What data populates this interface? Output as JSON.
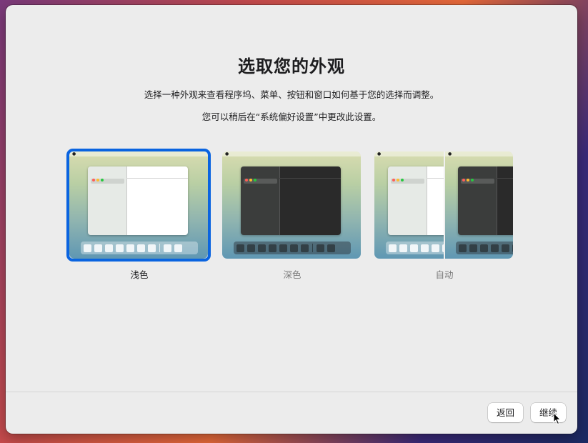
{
  "window": {
    "title": "选取您的外观",
    "description": "选择一种外观来查看程序坞、菜单、按钮和窗口如何基于您的选择而调整。",
    "note": "您可以稍后在“系统偏好设置”中更改此设置。"
  },
  "appearance_options": [
    {
      "id": "light",
      "label": "浅色",
      "selected": true
    },
    {
      "id": "dark",
      "label": "深色",
      "selected": false
    },
    {
      "id": "auto",
      "label": "自动",
      "selected": false
    }
  ],
  "footer": {
    "back_label": "返回",
    "continue_label": "继续"
  },
  "colors": {
    "selection_accent": "#0a64e0",
    "selected_label": "#1d1d1f",
    "unselected_label": "#7a7a7a",
    "traffic_red": "#ff5f57",
    "traffic_yellow": "#febc2e",
    "traffic_green": "#28c840"
  },
  "icons": [
    "apple-logo-icon",
    "traffic-light-icon",
    "pointer-cursor-icon"
  ]
}
